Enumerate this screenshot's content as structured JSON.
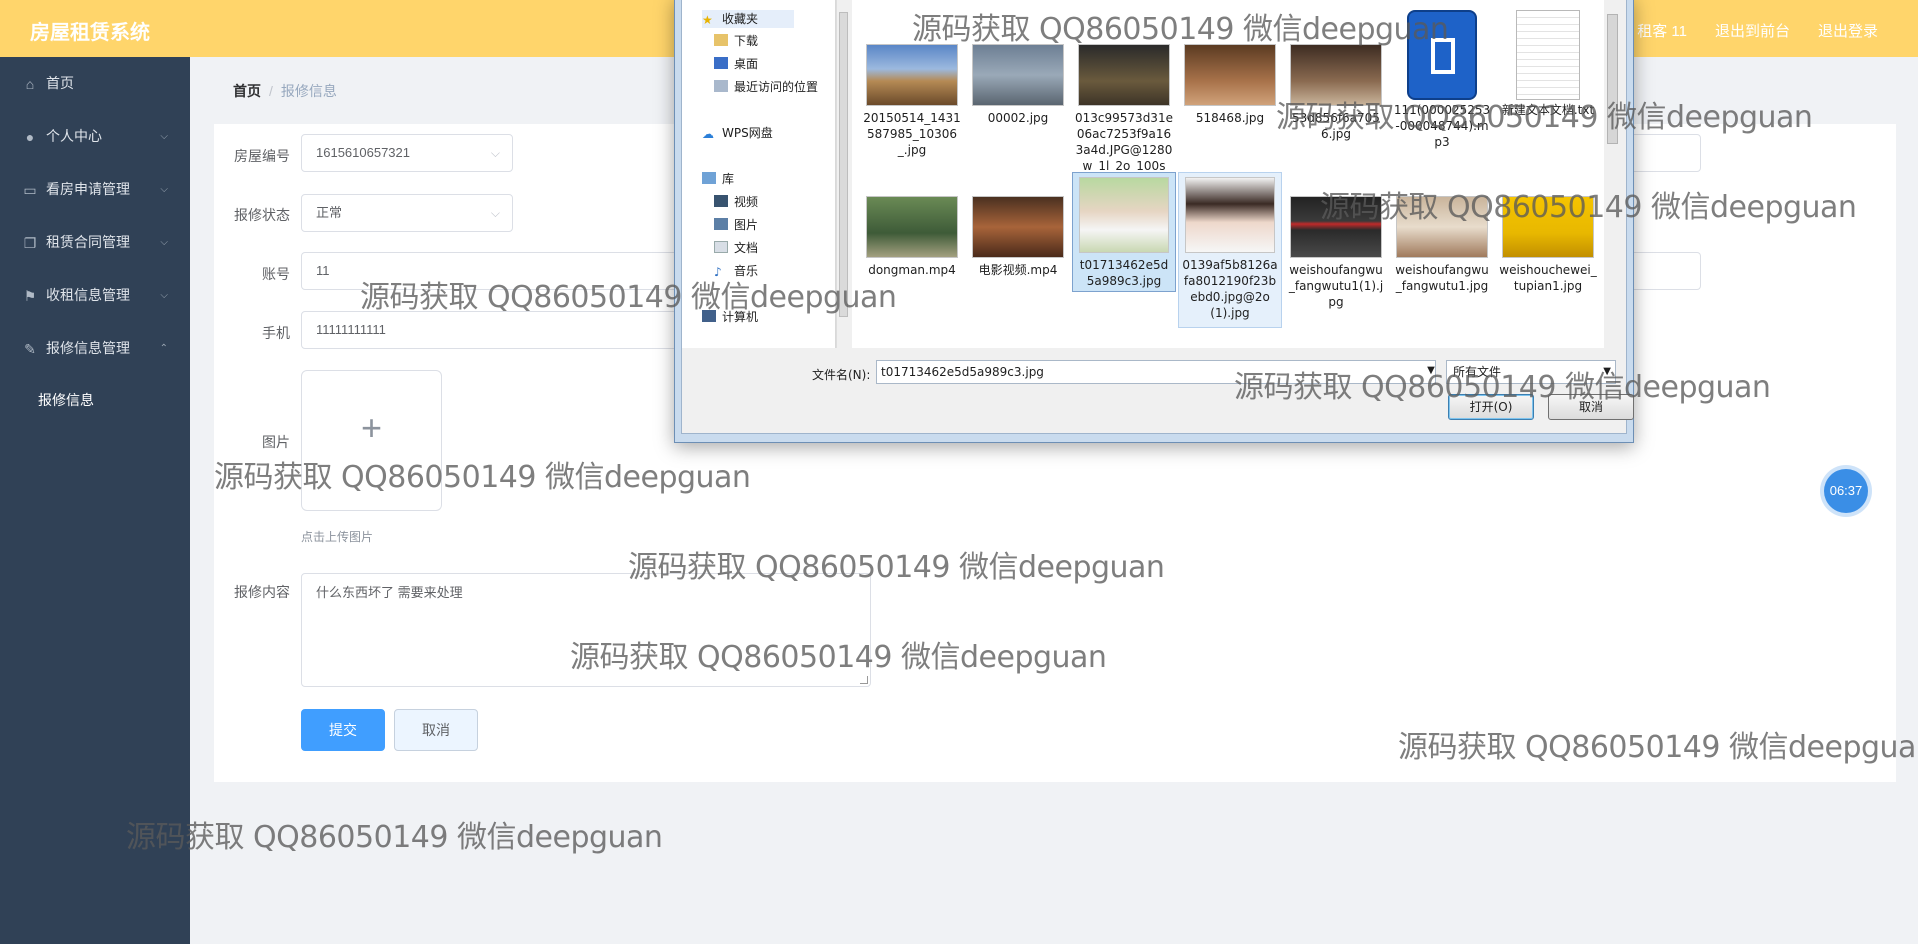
{
  "app": {
    "title": "房屋租赁系统",
    "top_links": [
      "租客 11",
      "退出到前台",
      "退出登录"
    ]
  },
  "sidebar": {
    "items": [
      {
        "label": "首页",
        "icon": "home-icon",
        "arrow": ""
      },
      {
        "label": "个人中心",
        "icon": "user-icon",
        "arrow": "⌵"
      },
      {
        "label": "看房申请管理",
        "icon": "chat-icon",
        "arrow": "⌵"
      },
      {
        "label": "租赁合同管理",
        "icon": "copy-icon",
        "arrow": "⌵"
      },
      {
        "label": "收租信息管理",
        "icon": "flag-icon",
        "arrow": "⌵"
      },
      {
        "label": "报修信息管理",
        "icon": "edit-icon",
        "arrow": "⌃"
      }
    ],
    "sub_item": "报修信息"
  },
  "breadcrumb": {
    "home": "首页",
    "sep": "/",
    "current": "报修信息"
  },
  "form": {
    "house_no_label": "房屋编号",
    "house_no_value": "1615610657321",
    "status_label": "报修状态",
    "status_value": "正常",
    "account_label": "账号",
    "account_value": "11",
    "phone_label": "手机",
    "phone_value": "11111111111",
    "image_label": "图片",
    "upload_plus": "+",
    "upload_tip": "点击上传图片",
    "content_label": "报修内容",
    "content_value": "什么东西坏了 需要来处理",
    "submit_label": "提交",
    "cancel_label": "取消"
  },
  "timer": "06:37",
  "dialog": {
    "nav": {
      "favorites": "收藏夹",
      "downloads": "下载",
      "desktop": "桌面",
      "recent": "最近访问的位置",
      "wps": "WPS网盘",
      "library": "库",
      "videos": "视频",
      "pictures": "图片",
      "documents": "文档",
      "music": "音乐",
      "computer": "计算机"
    },
    "files": [
      "20150514_1431587985_10306_.jpg",
      "00002.jpg",
      "013c99573d31e06ac7253f9a163a4d.JPG@1280w_1l_2o_100sh...",
      "518468.jpg",
      "53d856f6a7056.jpg",
      "111(000025253-000048744).mp3",
      "新建文本文档.txt",
      "dongman.mp4",
      "电影视频.mp4",
      "t01713462e5d5a989c3.jpg",
      "0139af5b8126afa8012190f23bebd0.jpg@2o(1).jpg",
      "weishoufangwu_fangwutu1(1).jpg",
      "weishoufangwu_fangwutu1.jpg",
      "weishouchewei_tupian1.jpg"
    ],
    "filename_label": "文件名(N):",
    "filename_value": "t01713462e5d5a989c3.jpg",
    "filetype_value": "所有文件",
    "open_label": "打开(O)",
    "cancel_label": "取消"
  },
  "watermark": "源码获取 QQ86050149 微信deepguan",
  "colors": {
    "topbar": "#ffd56b",
    "sidebar": "#304156",
    "primary": "#409eff"
  }
}
